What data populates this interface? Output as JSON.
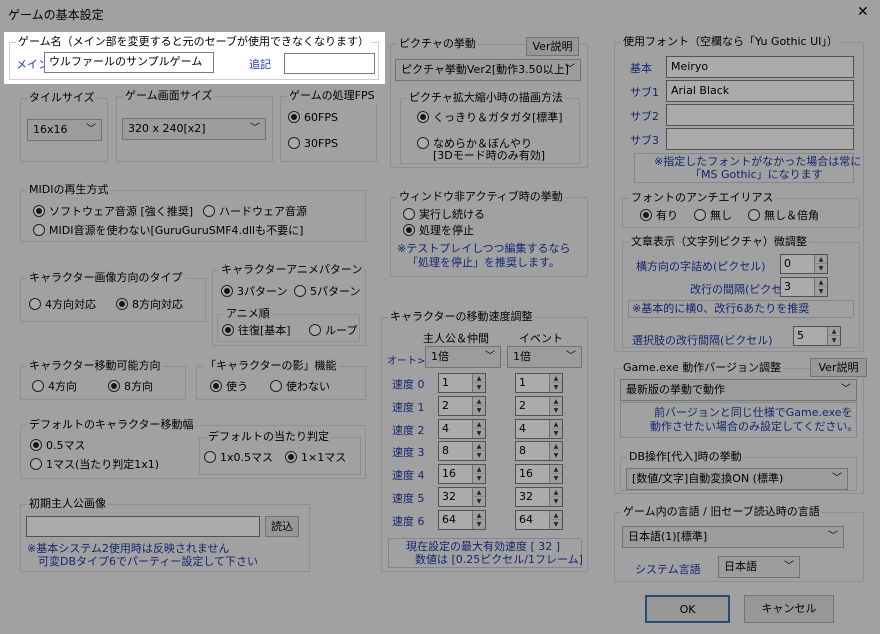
{
  "window": {
    "title": "ゲームの基本設定",
    "close": "✕"
  },
  "game_name": {
    "caption": "ゲーム名（メイン部を変更すると元のセーブが使用できなくなります）",
    "main_label": "メイン",
    "main_value": "ウルファールのサンプルゲーム",
    "sub_label": "追記",
    "sub_value": ""
  },
  "tile_size": {
    "caption": "タイルサイズ",
    "value": "16x16"
  },
  "screen_size": {
    "caption": "ゲーム画面サイズ",
    "value": "320 x 240[x2]"
  },
  "fps": {
    "caption": "ゲームの処理FPS",
    "opt1": "60FPS",
    "opt2": "30FPS"
  },
  "picture": {
    "caption": "ピクチャの挙動",
    "ver_button": "Ver説明",
    "mode": "ピクチャ挙動Ver2[動作3.50以上]",
    "scale_caption": "ピクチャ拡大縮小時の描画方法",
    "scale_opt1": "くっきり＆ガタガタ[標準]",
    "scale_opt2a": "なめらか＆ぼんやり",
    "scale_opt2b": "[3Dモード時のみ有効]"
  },
  "midi": {
    "caption": "MIDIの再生方式",
    "opt1": "ソフトウェア音源 [強く推奨]",
    "opt2": "ハードウェア音源",
    "opt3": "MIDI音源を使わない[GuruGuruSMF4.dllも不要に]"
  },
  "inactive": {
    "caption": "ウィンドウ非アクティブ時の挙動",
    "opt1": "実行し続ける",
    "opt2": "処理を停止",
    "note1": "※テストプレイしつつ編集するなら",
    "note2": "「処理を停止」を推奨します。"
  },
  "char_dir": {
    "caption": "キャラクター画像方向のタイプ",
    "opt1": "4方向対応",
    "opt2": "8方向対応"
  },
  "char_anim": {
    "caption": "キャラクターアニメパターン",
    "opt1": "3パターン",
    "opt2": "5パターン",
    "order_caption": "アニメ順",
    "order1": "往復[基本]",
    "order2": "ループ"
  },
  "char_move": {
    "caption": "キャラクター移動可能方向",
    "opt1": "4方向",
    "opt2": "8方向"
  },
  "char_shadow": {
    "caption": "「キャラクターの影」機能",
    "opt1": "使う",
    "opt2": "使わない"
  },
  "move_width": {
    "caption": "デフォルトのキャラクター移動幅",
    "opt1": "0.5マス",
    "opt2": "1マス(当たり判定1x1)",
    "hit_caption": "デフォルトの当たり判定",
    "hit1": "1x0.5マス",
    "hit2": "1×1マス"
  },
  "speed": {
    "caption": "キャラクターの移動速度調整",
    "col_hero": "主人公＆仲間",
    "col_event": "イベント",
    "auto_label": "オート>",
    "auto_hero": "1倍",
    "auto_event": "1倍",
    "rows": [
      {
        "label": "速度 0",
        "hero": "1",
        "event": "1"
      },
      {
        "label": "速度 1",
        "hero": "2",
        "event": "2"
      },
      {
        "label": "速度 2",
        "hero": "4",
        "event": "4"
      },
      {
        "label": "速度 3",
        "hero": "8",
        "event": "8"
      },
      {
        "label": "速度 4",
        "hero": "16",
        "event": "16"
      },
      {
        "label": "速度 5",
        "hero": "32",
        "event": "32"
      },
      {
        "label": "速度 6",
        "hero": "64",
        "event": "64"
      }
    ],
    "note1": "現在設定の最大有効速度 [ 32 ]",
    "note2": "数値は [0.25ピクセル/1フレーム]"
  },
  "initial_hero": {
    "caption": "初期主人公画像",
    "value": "",
    "load_button": "読込",
    "note1": "※基本システム2使用時は反映されません",
    "note2": "可変DBタイプ6でパーティー設定して下さい"
  },
  "fonts": {
    "caption": "使用フォント（空欄なら「Yu Gothic UI」）",
    "base_label": "基本",
    "base_value": "Meiryo",
    "sub1_label": "サブ1",
    "sub1_value": "Arial Black",
    "sub2_label": "サブ2",
    "sub2_value": "",
    "sub3_label": "サブ3",
    "sub3_value": "",
    "note1": "※指定したフォントがなかった場合は常に",
    "note2": "「MS Gothic」になります"
  },
  "antialias": {
    "caption": "フォントのアンチエイリアス",
    "opt1": "有り",
    "opt2": "無し",
    "opt3": "無し＆倍角"
  },
  "text_display": {
    "caption": "文章表示（文字列ピクチャ）微調整",
    "char_space_label": "横方向の字詰め(ピクセル)",
    "char_space_value": "0",
    "line_space_label": "改行の間隔(ピクセル)",
    "line_space_value": "3",
    "note": "※基本的に横0、改行6あたりを推奨",
    "choice_label": "選択肢の改行間隔(ピクセル)",
    "choice_value": "5"
  },
  "gameexe": {
    "caption": "Game.exe 動作バージョン調整",
    "ver_button": "Ver説明",
    "mode": "最新版の挙動で動作",
    "note1": "前バージョンと同じ仕様でGame.exeを",
    "note2": "動作させたい場合のみ設定してください。"
  },
  "db_op": {
    "caption": "DB操作[代入]時の挙動",
    "mode": "[数値/文字]自動変換ON (標準)"
  },
  "lang": {
    "caption": "ゲーム内の言語 / 旧セーブ読込時の言語",
    "value": "日本語(1)[標準]",
    "sys_label": "システム言語",
    "sys_value": "日本語"
  },
  "footer": {
    "ok": "OK",
    "cancel": "キャンセル"
  }
}
